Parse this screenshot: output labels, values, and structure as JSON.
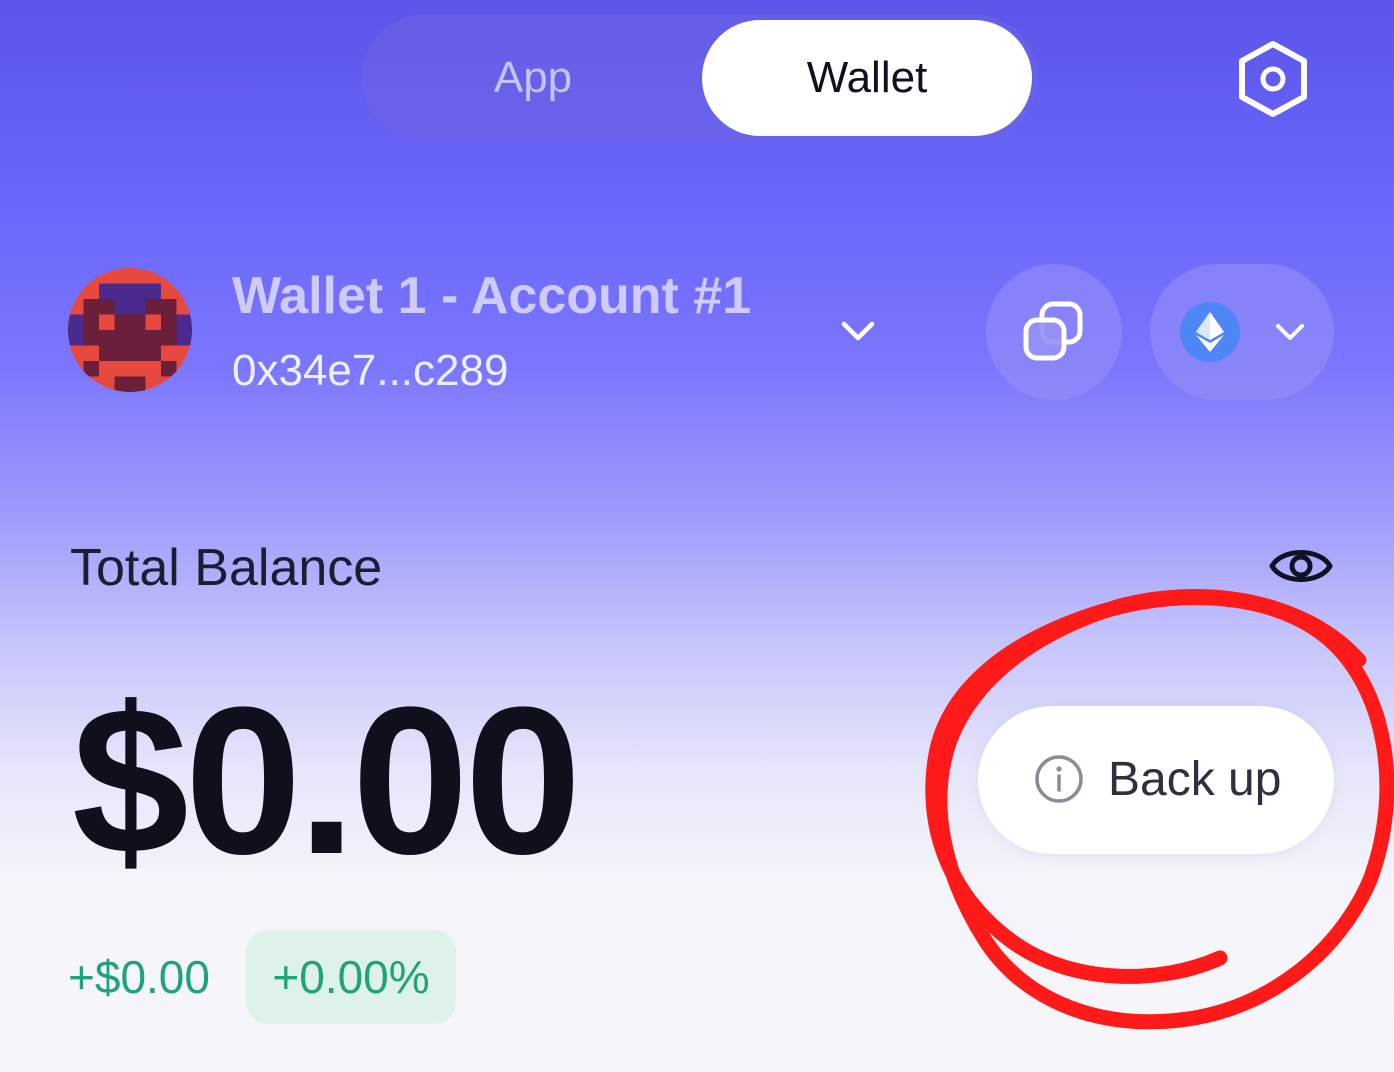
{
  "tabs": {
    "app_label": "App",
    "wallet_label": "Wallet",
    "active": "Wallet"
  },
  "account": {
    "name": "Wallet 1 - Account #1",
    "address": "0x34e7...c289"
  },
  "network": {
    "icon": "ethereum-icon"
  },
  "balance": {
    "label": "Total Balance",
    "amount": "$0.00",
    "change_amount": "+$0.00",
    "change_percent": "+0.00%"
  },
  "backup": {
    "label": "Back up"
  },
  "colors": {
    "accent_gradient_top": "#5b55e9",
    "positive": "#1fa37a",
    "annotation": "#ff1a1a"
  }
}
